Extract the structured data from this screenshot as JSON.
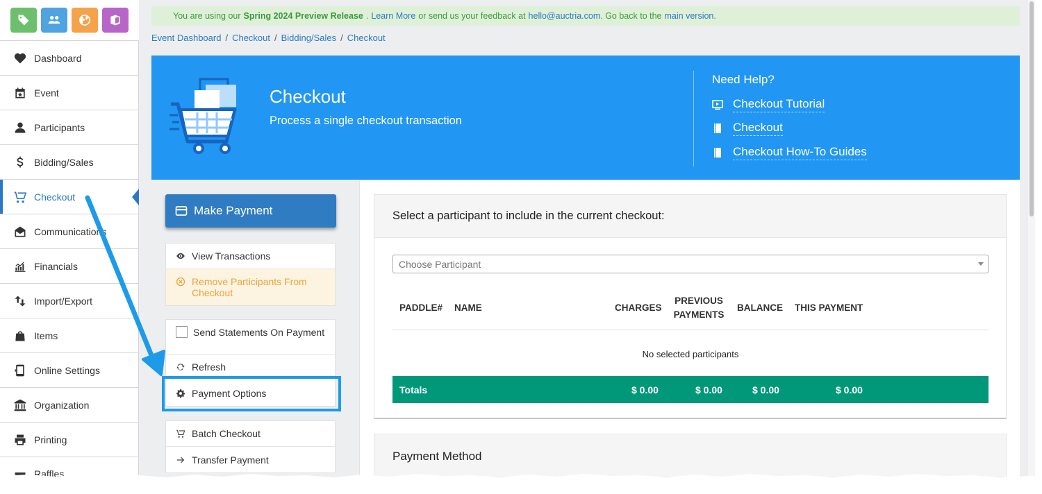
{
  "top_icons": [
    {
      "name": "tag-icon",
      "color": "#6cbf6c"
    },
    {
      "name": "people-icon",
      "color": "#4ea3e0"
    },
    {
      "name": "globe-icon",
      "color": "#f5a24a"
    },
    {
      "name": "book-icon",
      "color": "#b865c8"
    }
  ],
  "sidebar": {
    "items": [
      {
        "label": "Dashboard",
        "icon": "heart-pulse-icon"
      },
      {
        "label": "Event",
        "icon": "calendar-star-icon"
      },
      {
        "label": "Participants",
        "icon": "person-icon"
      },
      {
        "label": "Bidding/Sales",
        "icon": "dollar-icon"
      },
      {
        "label": "Checkout",
        "icon": "cart-icon",
        "active": true
      },
      {
        "label": "Communications",
        "icon": "envelope-open-icon"
      },
      {
        "label": "Financials",
        "icon": "bar-chart-icon"
      },
      {
        "label": "Import/Export",
        "icon": "swap-arrows-icon"
      },
      {
        "label": "Items",
        "icon": "shopping-bag-icon"
      },
      {
        "label": "Online Settings",
        "icon": "mobile-icon"
      },
      {
        "label": "Organization",
        "icon": "building-icon"
      },
      {
        "label": "Printing",
        "icon": "printer-icon"
      },
      {
        "label": "Raffles",
        "icon": "ticket-icon"
      }
    ]
  },
  "banner": {
    "prefix": "You are using our",
    "release": "Spring 2024 Preview Release",
    "learn_more": "Learn More",
    "middle": "or send us your feedback at",
    "email": "hello@auctria.com",
    "back_text": ". Go back to the",
    "main_version": "main version",
    "end": "."
  },
  "breadcrumbs": [
    "Event Dashboard",
    "Checkout",
    "Bidding/Sales",
    "Checkout"
  ],
  "hero": {
    "title": "Checkout",
    "subtitle": "Process a single checkout transaction",
    "help_title": "Need Help?",
    "help_links": [
      {
        "label": "Checkout Tutorial",
        "icon": "video-icon"
      },
      {
        "label": "Checkout",
        "icon": "book-icon"
      },
      {
        "label": "Checkout How-To Guides",
        "icon": "book-icon"
      }
    ]
  },
  "actions": {
    "make_payment": "Make Payment",
    "view_transactions": "View Transactions",
    "remove_participants": "Remove Participants From Checkout",
    "send_statements": "Send Statements On Payment",
    "send_statements_checked": false,
    "refresh": "Refresh",
    "payment_options": "Payment Options",
    "batch_checkout": "Batch Checkout",
    "transfer_payment": "Transfer Payment"
  },
  "checkout_panel": {
    "heading": "Select a participant to include in the current checkout:",
    "select_placeholder": "Choose Participant",
    "columns": [
      "PADDLE#",
      "NAME",
      "CHARGES",
      "PREVIOUS PAYMENTS",
      "BALANCE",
      "THIS PAYMENT"
    ],
    "empty_message": "No selected participants",
    "totals": {
      "label": "Totals",
      "charges": "$ 0.00",
      "previous_payments": "$ 0.00",
      "balance": "$ 0.00",
      "this_payment": "$ 0.00"
    }
  },
  "payment_method": {
    "heading": "Payment Method"
  },
  "colors": {
    "brand_blue": "#2196f3",
    "active_blue": "#2b79c2",
    "totals_green": "#009879",
    "annotation": "#1e9be8"
  }
}
